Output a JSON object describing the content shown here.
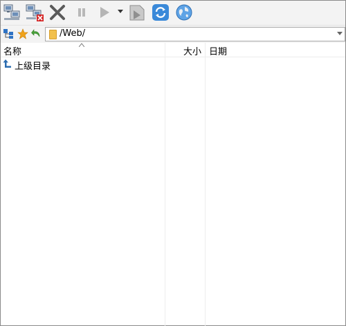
{
  "toolbar": {
    "buttons": [
      {
        "name": "connect",
        "icon": "network-computers-icon"
      },
      {
        "name": "disconnect",
        "icon": "network-computers-disconnect-icon"
      },
      {
        "name": "cancel",
        "icon": "close-x-icon"
      },
      {
        "name": "pause",
        "icon": "pause-icon"
      },
      {
        "name": "start",
        "icon": "play-icon"
      },
      {
        "name": "start-dropdown",
        "icon": "chevron-down-icon"
      },
      {
        "name": "queue",
        "icon": "queue-icon"
      },
      {
        "name": "refresh",
        "icon": "refresh-icon"
      },
      {
        "name": "browser",
        "icon": "globe-icon"
      }
    ]
  },
  "address_bar": {
    "path": "/Web/"
  },
  "list": {
    "columns": {
      "name": "名称",
      "size": "大小",
      "date": "日期"
    },
    "rows": [
      {
        "label": "上级目录",
        "icon": "up-arrow-icon"
      }
    ]
  },
  "colors": {
    "toolbar_bg": "#f3f3f3",
    "refresh_blue": "#2f7fd4",
    "cancel_gray": "#5a5a5a",
    "up_arrow_blue": "#2b6cb0",
    "folder_yellow": "#f2c14e"
  }
}
